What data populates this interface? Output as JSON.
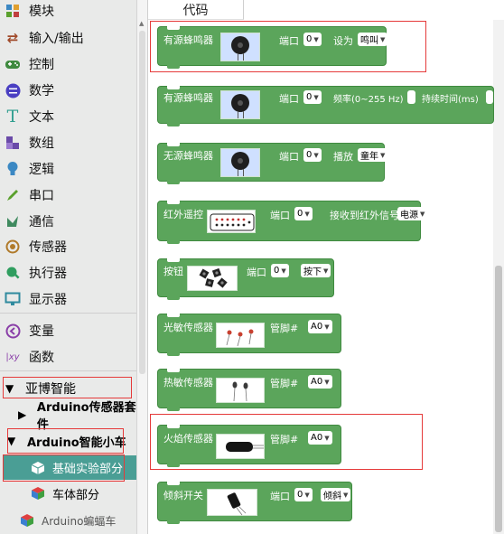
{
  "sidebar": {
    "categories": [
      {
        "label": "模块",
        "icon": "puzzle-icon",
        "color": "#3b88c3"
      },
      {
        "label": "输入/输出",
        "icon": "io-icon",
        "color": "#a04a2a"
      },
      {
        "label": "控制",
        "icon": "gamepad-icon",
        "color": "#3f8a3f"
      },
      {
        "label": "数学",
        "icon": "math-icon",
        "color": "#4a3fc2"
      },
      {
        "label": "文本",
        "icon": "text-icon",
        "color": "#2f9e8f"
      },
      {
        "label": "数组",
        "icon": "array-icon",
        "color": "#6a4aa8"
      },
      {
        "label": "逻辑",
        "icon": "bulb-icon",
        "color": "#3b88c3"
      },
      {
        "label": "串口",
        "icon": "pen-icon",
        "color": "#5aa02c"
      },
      {
        "label": "通信",
        "icon": "comm-icon",
        "color": "#3f8a5f"
      },
      {
        "label": "传感器",
        "icon": "sensor-icon",
        "color": "#b07a2a"
      },
      {
        "label": "执行器",
        "icon": "actuator-icon",
        "color": "#2f9e5f"
      },
      {
        "label": "显示器",
        "icon": "monitor-icon",
        "color": "#2f8a9e"
      },
      {
        "label": "变量",
        "icon": "variable-icon",
        "color": "#8a3fa8"
      },
      {
        "label": "函数",
        "icon": "function-icon",
        "color": "#8a3fa8"
      }
    ],
    "tree": {
      "yabo": "亚博智能",
      "sensor_kit": "Arduino传感器套件",
      "smart_car": "Arduino智能小车",
      "basic_exp": "基础实验部分",
      "car_body": "车体部分",
      "more": "Arduino蝙蝠车"
    }
  },
  "workspace": {
    "tab_label": "代码",
    "common": {
      "port": "端口",
      "pin": "管脚#"
    },
    "blocks": [
      {
        "title": "有源蜂鸣器",
        "port_value": "0",
        "set_label": "设为",
        "set_value": "鸣叫"
      },
      {
        "title": "有源蜂鸣器",
        "port_value": "0",
        "freq_label": "频率(0~255 Hz)",
        "duration_label": "持续时间(ms)"
      },
      {
        "title": "无源蜂鸣器",
        "port_value": "0",
        "play_label": "播放",
        "play_value": "童年"
      },
      {
        "title": "红外遥控",
        "port_value": "0",
        "receive_label": "接收到红外信号",
        "receive_value": "电源"
      },
      {
        "title": "按钮",
        "port_value": "0",
        "state_value": "按下"
      },
      {
        "title": "光敏传感器",
        "pin_value": "A0"
      },
      {
        "title": "热敏传感器",
        "pin_value": "A0"
      },
      {
        "title": "火焰传感器",
        "pin_value": "A0"
      },
      {
        "title": "倾斜开关",
        "port_value": "0",
        "tilt_value": "倾斜"
      }
    ]
  },
  "colors": {
    "block_green": "#5ba55b",
    "selection_teal": "#4a9e95",
    "highlight_red": "#e53a3a"
  }
}
